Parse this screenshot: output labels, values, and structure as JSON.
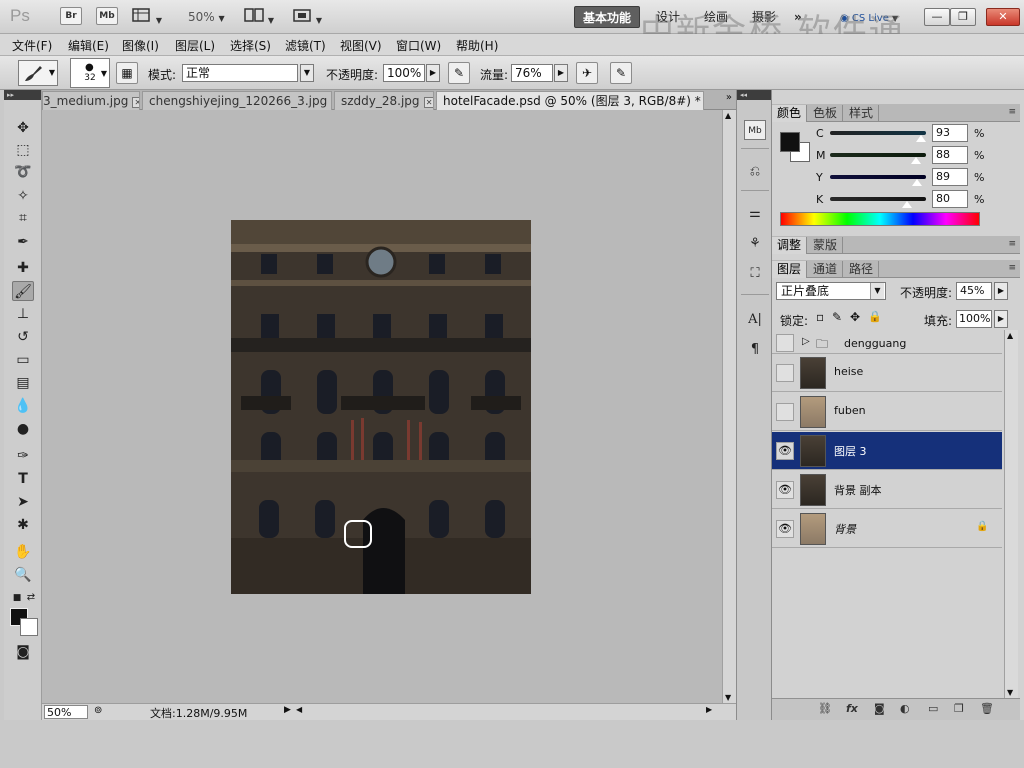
{
  "app": {
    "logo": "Ps",
    "bridge_button": "Br",
    "minibridge_button": "Mb",
    "zoom": "50%"
  },
  "workspaces": {
    "active": "基本功能",
    "design": "设计",
    "painting": "绘画",
    "photography": "摄影",
    "more": "»",
    "cslive": "CS Live"
  },
  "window_controls": {
    "minimize": "—",
    "restore": "❐",
    "close": "✕"
  },
  "watermark": "中新金桥 软件通",
  "menu": [
    "文件(F)",
    "编辑(E)",
    "图像(I)",
    "图层(L)",
    "选择(S)",
    "滤镜(T)",
    "视图(V)",
    "窗口(W)",
    "帮助(H)"
  ],
  "options": {
    "brush_size": "32",
    "mode_label": "模式:",
    "mode_value": "正常",
    "opacity_label": "不透明度:",
    "opacity_value": "100%",
    "flow_label": "流量:",
    "flow_value": "76%"
  },
  "tabs": [
    {
      "label": "3_medium.jpg",
      "active": false
    },
    {
      "label": "chengshiyejing_120266_3.jpg",
      "active": false
    },
    {
      "label": "szddy_28.jpg",
      "active": false
    },
    {
      "label": "hotelFacade.psd @ 50% (图层 3, RGB/8#) *",
      "active": true
    }
  ],
  "status": {
    "zoom": "50%",
    "doc_info": "文档:1.28M/9.95M"
  },
  "color_panel": {
    "tabs": [
      "颜色",
      "色板",
      "样式"
    ],
    "cmyk": [
      {
        "label": "C",
        "value": "93",
        "unit": "%",
        "color": "#d23b3b"
      },
      {
        "label": "M",
        "value": "88",
        "unit": "%",
        "color": "#3f9a3f"
      },
      {
        "label": "Y",
        "value": "89",
        "unit": "%",
        "color": "#3a3aa8"
      },
      {
        "label": "K",
        "value": "80",
        "unit": "%",
        "color": "#555555"
      }
    ],
    "fg_color": "#111111",
    "bg_color": "#ffffff"
  },
  "adjust_panel": {
    "tabs": [
      "调整",
      "蒙版"
    ]
  },
  "layers_panel": {
    "tabs": [
      "图层",
      "通道",
      "路径"
    ],
    "blend_mode": "正片叠底",
    "opacity_label": "不透明度:",
    "opacity_value": "45%",
    "lock_label": "锁定:",
    "fill_label": "填充:",
    "fill_value": "100%",
    "group": {
      "name": "dengguang"
    },
    "layers": [
      {
        "name": "heise",
        "visible": false,
        "selected": false,
        "thumb": "dark"
      },
      {
        "name": "fuben",
        "visible": false,
        "selected": false,
        "thumb": "light"
      },
      {
        "name": "图层 3",
        "visible": true,
        "selected": true,
        "thumb": "dark"
      },
      {
        "name": "背景 副本",
        "visible": true,
        "selected": false,
        "thumb": "dark"
      },
      {
        "name": "背景",
        "visible": true,
        "selected": false,
        "thumb": "light",
        "locked": true
      }
    ]
  }
}
